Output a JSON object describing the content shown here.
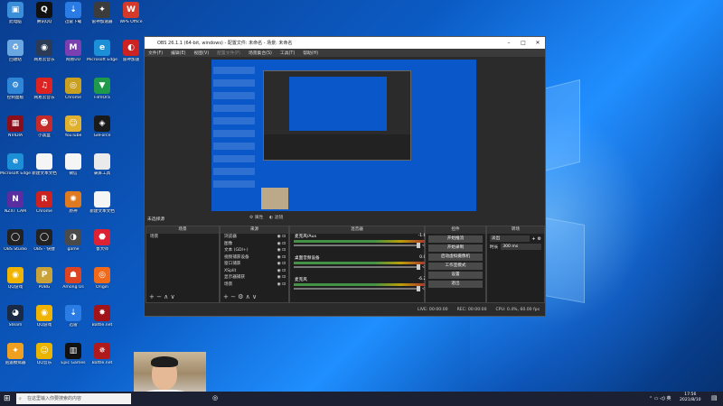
{
  "desktop": {
    "icons": [
      {
        "col": 0,
        "row": 0,
        "label": "此电脑",
        "color": "#3a8fd8",
        "glyph": "▣",
        "icon": "computer-icon"
      },
      {
        "col": 1,
        "row": 0,
        "label": "腾讯QQ",
        "color": "#111",
        "glyph": "Q",
        "icon": "qq-icon"
      },
      {
        "col": 2,
        "row": 0,
        "label": "迅雷下载",
        "color": "#2a7be4",
        "glyph": "⇣",
        "icon": "thunder-icon"
      },
      {
        "col": 3,
        "row": 0,
        "label": "雷神加速器",
        "color": "#3c3c3c",
        "glyph": "✦",
        "icon": "accelerator-icon"
      },
      {
        "col": 4,
        "row": 0,
        "label": "WPS Office",
        "color": "#d43a2a",
        "glyph": "W",
        "icon": "wps-icon"
      },
      {
        "col": 0,
        "row": 1,
        "label": "回收站",
        "color": "#6aa6e0",
        "glyph": "♻",
        "icon": "recycle-bin-icon"
      },
      {
        "col": 1,
        "row": 1,
        "label": "网易云音乐",
        "color": "#2b3a55",
        "glyph": "◉",
        "icon": "steam-tool-icon"
      },
      {
        "col": 2,
        "row": 1,
        "label": "网易UU",
        "color": "#7a3fb0",
        "glyph": "M",
        "icon": "app-icon"
      },
      {
        "col": 3,
        "row": 1,
        "label": "Microsoft Edge",
        "color": "#1c8fd6",
        "glyph": "e",
        "icon": "edge-icon"
      },
      {
        "col": 4,
        "row": 1,
        "label": "雷神加速",
        "color": "#c22",
        "glyph": "◐",
        "icon": "game-icon"
      },
      {
        "col": 0,
        "row": 2,
        "label": "控制面板",
        "color": "#2f86d6",
        "glyph": "⚙",
        "icon": "control-panel-icon"
      },
      {
        "col": 1,
        "row": 2,
        "label": "网易云音乐",
        "color": "#d22",
        "glyph": "♫",
        "icon": "netease-music-icon"
      },
      {
        "col": 2,
        "row": 2,
        "label": "Chrome",
        "color": "#c9a020",
        "glyph": "◎",
        "icon": "chrome-icon"
      },
      {
        "col": 3,
        "row": 2,
        "label": "FilmOra",
        "color": "#1f9a4a",
        "glyph": "▼",
        "icon": "video-editor-icon"
      },
      {
        "col": 0,
        "row": 3,
        "label": "NVIDIA",
        "color": "#8b0f1a",
        "glyph": "▦",
        "icon": "game-launcher-icon"
      },
      {
        "col": 1,
        "row": 3,
        "label": "小黑盒",
        "color": "#c52b2b",
        "glyph": "☻",
        "icon": "helper-icon"
      },
      {
        "col": 2,
        "row": 3,
        "label": "YouTube",
        "color": "#e0b030",
        "glyph": "☺",
        "icon": "chat-icon"
      },
      {
        "col": 3,
        "row": 3,
        "label": "GeForce",
        "color": "#1a1a1a",
        "glyph": "◈",
        "icon": "nvidia-icon"
      },
      {
        "col": 0,
        "row": 4,
        "label": "Microsoft Edge",
        "color": "#1c8fd6",
        "glyph": "e",
        "icon": "edge-icon-2"
      },
      {
        "col": 1,
        "row": 4,
        "label": "新建文本文档",
        "color": "#f5f5f5",
        "glyph": "",
        "icon": "document-icon"
      },
      {
        "col": 2,
        "row": 4,
        "label": "微信",
        "color": "#f5f5f5",
        "glyph": "",
        "icon": "document-icon-2"
      },
      {
        "col": 3,
        "row": 4,
        "label": "录屏工具",
        "color": "#eaeaea",
        "glyph": "",
        "icon": "file-icon"
      },
      {
        "col": 0,
        "row": 5,
        "label": "NZXT CAM",
        "color": "#5a2ea0",
        "glyph": "N",
        "icon": "nzxt-icon"
      },
      {
        "col": 1,
        "row": 5,
        "label": "Chrome",
        "color": "#c22",
        "glyph": "R",
        "icon": "rockstar-icon"
      },
      {
        "col": 2,
        "row": 5,
        "label": "原神",
        "color": "#e07a20",
        "glyph": "✺",
        "icon": "genshin-icon"
      },
      {
        "col": 3,
        "row": 5,
        "label": "新建文本文档",
        "color": "#f5f5f5",
        "glyph": "",
        "icon": "document-icon-3"
      },
      {
        "col": 0,
        "row": 6,
        "label": "OBS Studio",
        "color": "#222",
        "glyph": "◯",
        "icon": "obs-icon"
      },
      {
        "col": 1,
        "row": 6,
        "label": "OBS - 快捷",
        "color": "#222",
        "glyph": "◯",
        "icon": "obs-icon-2"
      },
      {
        "col": 2,
        "row": 6,
        "label": "game",
        "color": "#4a4a4a",
        "glyph": "◑",
        "icon": "app-icon-2"
      },
      {
        "col": 3,
        "row": 6,
        "label": "鲁大师",
        "color": "#d23",
        "glyph": "⬣",
        "icon": "app-icon-3"
      },
      {
        "col": 0,
        "row": 7,
        "label": "QQ游戏",
        "color": "#f0b400",
        "glyph": "◉",
        "icon": "qq-game-icon"
      },
      {
        "col": 1,
        "row": 7,
        "label": "PUBG",
        "color": "#c9a23a",
        "glyph": "P",
        "icon": "pubg-icon"
      },
      {
        "col": 2,
        "row": 7,
        "label": "Among Us",
        "color": "#d42",
        "glyph": "☗",
        "icon": "among-us-icon"
      },
      {
        "col": 3,
        "row": 7,
        "label": "Origin",
        "color": "#f06a1a",
        "glyph": "◎",
        "icon": "origin-icon"
      },
      {
        "col": 0,
        "row": 8,
        "label": "Steam",
        "color": "#1b2a44",
        "glyph": "◕",
        "icon": "steam-icon"
      },
      {
        "col": 1,
        "row": 8,
        "label": "QQ游戏",
        "color": "#f0b400",
        "glyph": "◉",
        "icon": "qq-game-icon-2"
      },
      {
        "col": 2,
        "row": 8,
        "label": "迅雷",
        "color": "#2a7be4",
        "glyph": "⇣",
        "icon": "downloader-icon"
      },
      {
        "col": 3,
        "row": 8,
        "label": "Battle.net",
        "color": "#a1141a",
        "glyph": "✸",
        "icon": "battlenet-icon"
      },
      {
        "col": 0,
        "row": 9,
        "label": "逍遥模拟器",
        "color": "#f0a020",
        "glyph": "✦",
        "icon": "emulator-icon"
      },
      {
        "col": 1,
        "row": 9,
        "label": "QQ音乐",
        "color": "#e8b400",
        "glyph": "☺",
        "icon": "music-icon"
      },
      {
        "col": 2,
        "row": 9,
        "label": "Epic Games",
        "color": "#111",
        "glyph": "▥",
        "icon": "epic-icon"
      },
      {
        "col": 3,
        "row": 9,
        "label": "Battle.net",
        "color": "#b01a1a",
        "glyph": "✵",
        "icon": "battlenet-icon-2"
      }
    ]
  },
  "obs": {
    "title": "OBS 26.1.1 (64-bit, windows) - 配置文件: 未命名 - 场景: 未命名",
    "menu": [
      "文件(F)",
      "编辑(E)",
      "视图(V)",
      "配置文件(P)",
      "场景集合(S)",
      "工具(T)",
      "帮助(H)"
    ],
    "no_source_label": "未选择源",
    "properties_label": "属性",
    "filters_label": "滤镜",
    "docks": {
      "scenes": "场景",
      "sources": "来源",
      "mixer": "混音器",
      "transitions": "转场",
      "controls": "控件"
    },
    "scenes": [
      "场景"
    ],
    "sources": [
      "浏览器",
      "图像",
      "文本 (GDI+)",
      "视频捕获设备",
      "窗口捕获",
      "XSplit",
      "显示器捕获",
      "场景"
    ],
    "mixer": [
      {
        "name": "麦克风/Aux",
        "db": "-1.6 dB"
      },
      {
        "name": "桌面音频设备",
        "db": "0.0 dB"
      },
      {
        "name": "麦克风",
        "db": "-6.2 dB"
      }
    ],
    "transition": {
      "type": "淡出",
      "duration_label": "时长",
      "duration": "300 ms"
    },
    "controls": [
      "开始推流",
      "开始录制",
      "启动虚拟摄像机",
      "工作室模式",
      "设置",
      "退出"
    ],
    "status": {
      "live": "LIVE: 00:00:00",
      "rec": "REC: 00:00:00",
      "cpu": "CPU: 0.4%, 60.00 fps"
    }
  },
  "taskbar": {
    "search_placeholder": "在这里输入你要搜索的内容",
    "time": "17:56",
    "date": "2021/8/10"
  }
}
